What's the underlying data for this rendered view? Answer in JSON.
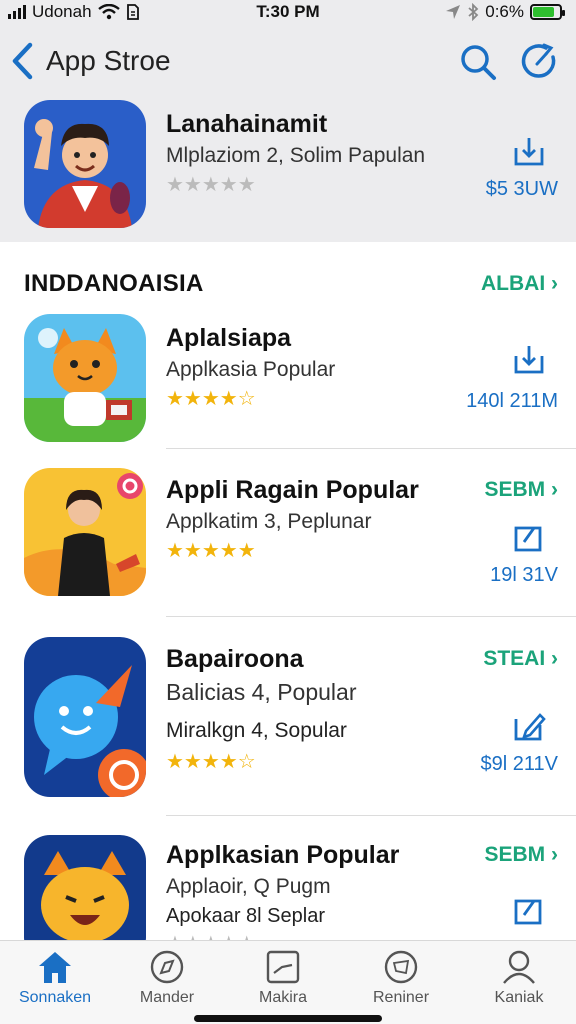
{
  "status_bar": {
    "carrier": "Udonah",
    "time": "T:30 PM",
    "battery": "0:6%",
    "battery_level": 0.8,
    "icons": [
      "signal-icon",
      "wifi-icon",
      "sim-icon",
      "location-icon",
      "bluetooth-icon",
      "battery-icon"
    ]
  },
  "nav": {
    "title": "App Stroe",
    "icons": [
      "chevron-left-icon",
      "search-icon",
      "refresh-icon"
    ]
  },
  "featured": {
    "name": "Lanahainamit",
    "subtitle": "Mlplaziom 2, Solim Papulan",
    "stars": "★★★★★",
    "price": "$5  3UW",
    "icon": "cartoon-man-waving-icon"
  },
  "section": {
    "title": "INDDANOAISIA",
    "see_all": "ALBAI ›"
  },
  "apps": [
    {
      "name": "Aplalsiapa",
      "subtitle": "Applkasia Popular",
      "stars": "★★★★☆",
      "size": "140l  211M",
      "icon": "cartoon-cat-icon"
    },
    {
      "name": "Appli  Ragain Popular",
      "subtitle": "Applkatim 3, Peplunar",
      "stars": "★★★★★",
      "action": "SEBM ›",
      "size": "19l  31V",
      "icon": "woman-sitting-icon"
    },
    {
      "name": "Bapairoona",
      "subtitle": "Balicias 4, Popular",
      "subtitle2": "Miralkgn 4, Sopular",
      "stars": "★★★★☆",
      "action": "STEAI ›",
      "size": "$9l  211V",
      "icon": "chat-bubble-icon"
    },
    {
      "name": "Applkasian Popular",
      "subtitle": "Applaoir, Q Pugm",
      "subtitle2": "Apokaar 8l Seplar",
      "stars": "★★★★★",
      "action": "SEBM ›",
      "icon": "cartoon-fox-icon"
    }
  ],
  "tabs": [
    {
      "label": "Sonnaken",
      "icon": "home-icon",
      "active": true
    },
    {
      "label": "Mander",
      "icon": "compass-icon",
      "active": false
    },
    {
      "label": "Makira",
      "icon": "chart-icon",
      "active": false
    },
    {
      "label": "Reniner",
      "icon": "badge-icon",
      "active": false
    },
    {
      "label": "Kaniak",
      "icon": "person-icon",
      "active": false
    }
  ],
  "colors": {
    "accent": "#1a6fc4",
    "green": "#1ba37a",
    "star": "#f2b40c"
  }
}
